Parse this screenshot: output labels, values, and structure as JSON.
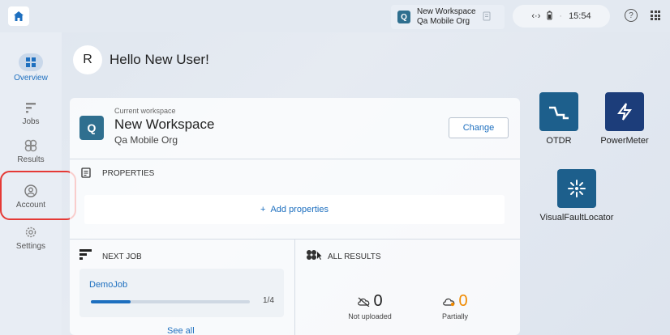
{
  "topbar": {
    "workspace_chip": {
      "letter": "Q",
      "name": "New Workspace",
      "org": "Qa Mobile Org"
    },
    "status": {
      "connection_icon": "network-icon",
      "battery_icon": "battery-icon",
      "time": "15:54"
    },
    "help_icon": "help-icon",
    "apps_icon": "apps-grid-icon"
  },
  "sidebar": {
    "items": [
      {
        "label": "Overview",
        "icon": "dashboard-icon",
        "active": true
      },
      {
        "label": "Jobs",
        "icon": "jobs-icon"
      },
      {
        "label": "Results",
        "icon": "results-icon"
      },
      {
        "label": "Account",
        "icon": "account-icon"
      },
      {
        "label": "Settings",
        "icon": "settings-icon"
      }
    ]
  },
  "greeting": {
    "avatar_letter": "R",
    "text": "Hello New User!"
  },
  "workspace": {
    "label": "Current workspace",
    "letter": "Q",
    "name": "New Workspace",
    "org": "Qa Mobile Org",
    "change_label": "Change"
  },
  "properties": {
    "title": "PROPERTIES",
    "add_label": "Add properties"
  },
  "next_job": {
    "title": "NEXT JOB",
    "job_name": "DemoJob",
    "progress": 0.25,
    "count": "1/4",
    "see_all": "See all"
  },
  "all_results": {
    "title": "ALL RESULTS",
    "not_uploaded": {
      "value": "0",
      "label": "Not uploaded"
    },
    "partially": {
      "value": "0",
      "label": "Partially"
    }
  },
  "apps": [
    {
      "name": "OTDR",
      "icon": "otdr-trace-icon"
    },
    {
      "name": "PowerMeter",
      "icon": "lightning-icon"
    },
    {
      "name": "VisualFaultLocator",
      "icon": "laser-burst-icon"
    }
  ],
  "colors": {
    "accent": "#1d6fbf",
    "workspace": "#2f6f8f",
    "orange": "#f08a00",
    "annotation": "#e53935"
  }
}
